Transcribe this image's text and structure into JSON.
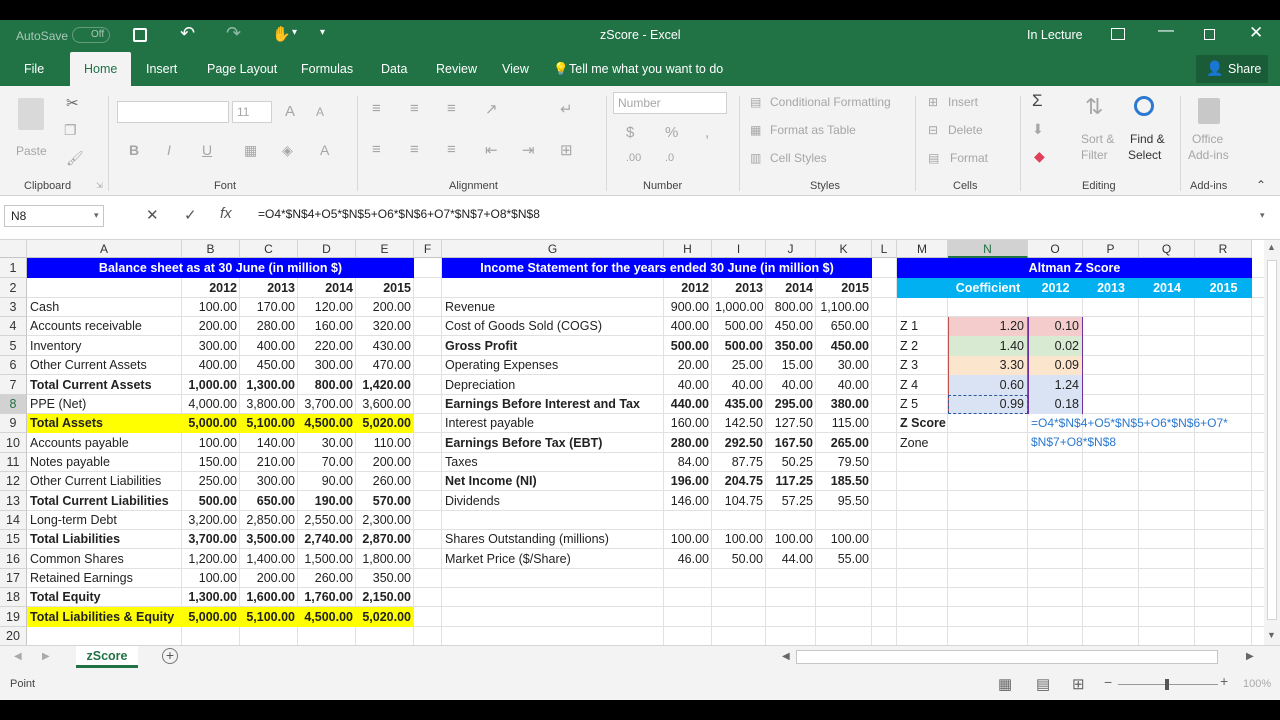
{
  "window": {
    "autosave": "AutoSave",
    "autosave_state": "Off",
    "title": "zScore  -  Excel",
    "user": "In Lecture"
  },
  "tabs": [
    "File",
    "Home",
    "Insert",
    "Page Layout",
    "Formulas",
    "Data",
    "Review",
    "View"
  ],
  "tell_me": "Tell me what you want to do",
  "share": "Share",
  "ribbon": {
    "paste": "Paste",
    "clipboard": "Clipboard",
    "font_size": "11",
    "font": "Font",
    "alignment": "Alignment",
    "number_format": "Number",
    "number": "Number",
    "conditional": "Conditional Formatting",
    "format_table": "Format as Table",
    "cell_styles": "Cell Styles",
    "styles": "Styles",
    "insert": "Insert",
    "delete": "Delete",
    "format": "Format",
    "cells": "Cells",
    "sort": "Sort &",
    "filter": "Filter",
    "find": "Find &",
    "select": "Select",
    "editing": "Editing",
    "office": "Office",
    "addins_btn": "Add-ins",
    "addins": "Add-ins"
  },
  "namebox": "N8",
  "formula": "=O4*$N$4+O5*$N$5+O6*$N$6+O7*$N$7+O8*$N$8",
  "columns": [
    "A",
    "B",
    "C",
    "D",
    "E",
    "F",
    "G",
    "H",
    "I",
    "J",
    "K",
    "L",
    "M",
    "N",
    "O",
    "P",
    "Q",
    "R"
  ],
  "rows": [
    "1",
    "2",
    "3",
    "4",
    "5",
    "6",
    "7",
    "8",
    "9",
    "10",
    "11",
    "12",
    "13",
    "14",
    "15",
    "16",
    "17",
    "18",
    "19",
    "20"
  ],
  "balance": {
    "title": "Balance sheet as at 30 June (in million $)",
    "years": [
      "2012",
      "2013",
      "2014",
      "2015"
    ],
    "items": [
      {
        "label": "Cash",
        "v": [
          "100.00",
          "170.00",
          "120.00",
          "200.00"
        ]
      },
      {
        "label": "Accounts receivable",
        "v": [
          "200.00",
          "280.00",
          "160.00",
          "320.00"
        ]
      },
      {
        "label": "Inventory",
        "v": [
          "300.00",
          "400.00",
          "220.00",
          "430.00"
        ]
      },
      {
        "label": "Other Current Assets",
        "v": [
          "400.00",
          "450.00",
          "300.00",
          "470.00"
        ]
      },
      {
        "label": "Total Current Assets",
        "v": [
          "1,000.00",
          "1,300.00",
          "800.00",
          "1,420.00"
        ]
      },
      {
        "label": "PPE (Net)",
        "v": [
          "4,000.00",
          "3,800.00",
          "3,700.00",
          "3,600.00"
        ]
      },
      {
        "label": "Total Assets",
        "v": [
          "5,000.00",
          "5,100.00",
          "4,500.00",
          "5,020.00"
        ]
      },
      {
        "label": "Accounts payable",
        "v": [
          "100.00",
          "140.00",
          "30.00",
          "110.00"
        ]
      },
      {
        "label": "Notes payable",
        "v": [
          "150.00",
          "210.00",
          "70.00",
          "200.00"
        ]
      },
      {
        "label": "Other Current Liabilities",
        "v": [
          "250.00",
          "300.00",
          "90.00",
          "260.00"
        ]
      },
      {
        "label": "Total Current Liabilities",
        "v": [
          "500.00",
          "650.00",
          "190.00",
          "570.00"
        ]
      },
      {
        "label": "Long-term Debt",
        "v": [
          "3,200.00",
          "2,850.00",
          "2,550.00",
          "2,300.00"
        ]
      },
      {
        "label": "Total Liabilities",
        "v": [
          "3,700.00",
          "3,500.00",
          "2,740.00",
          "2,870.00"
        ]
      },
      {
        "label": "Common Shares",
        "v": [
          "1,200.00",
          "1,400.00",
          "1,500.00",
          "1,800.00"
        ]
      },
      {
        "label": "Retained Earnings",
        "v": [
          "100.00",
          "200.00",
          "260.00",
          "350.00"
        ]
      },
      {
        "label": "Total Equity",
        "v": [
          "1,300.00",
          "1,600.00",
          "1,760.00",
          "2,150.00"
        ]
      },
      {
        "label": "Total Liabilities & Equity",
        "v": [
          "5,000.00",
          "5,100.00",
          "4,500.00",
          "5,020.00"
        ]
      }
    ]
  },
  "income": {
    "title": "Income Statement for the years ended 30 June (in million $)",
    "years": [
      "2012",
      "2013",
      "2014",
      "2015"
    ],
    "items": [
      {
        "label": "Revenue",
        "v": [
          "900.00",
          "1,000.00",
          "800.00",
          "1,100.00"
        ]
      },
      {
        "label": "Cost of Goods Sold (COGS)",
        "v": [
          "400.00",
          "500.00",
          "450.00",
          "650.00"
        ]
      },
      {
        "label": "Gross Profit",
        "v": [
          "500.00",
          "500.00",
          "350.00",
          "450.00"
        ]
      },
      {
        "label": "Operating Expenses",
        "v": [
          "20.00",
          "25.00",
          "15.00",
          "30.00"
        ]
      },
      {
        "label": "Depreciation",
        "v": [
          "40.00",
          "40.00",
          "40.00",
          "40.00"
        ]
      },
      {
        "label": "Earnings Before Interest and Tax",
        "v": [
          "440.00",
          "435.00",
          "295.00",
          "380.00"
        ]
      },
      {
        "label": "Interest payable",
        "v": [
          "160.00",
          "142.50",
          "127.50",
          "115.00"
        ]
      },
      {
        "label": "Earnings Before Tax (EBT)",
        "v": [
          "280.00",
          "292.50",
          "167.50",
          "265.00"
        ]
      },
      {
        "label": "Taxes",
        "v": [
          "84.00",
          "87.75",
          "50.25",
          "79.50"
        ]
      },
      {
        "label": "Net Income (NI)",
        "v": [
          "196.00",
          "204.75",
          "117.25",
          "185.50"
        ]
      },
      {
        "label": "Dividends",
        "v": [
          "146.00",
          "104.75",
          "57.25",
          "95.50"
        ]
      },
      {
        "label": "",
        "v": [
          "",
          "",
          "",
          ""
        ]
      },
      {
        "label": "Shares Outstanding (millions)",
        "v": [
          "100.00",
          "100.00",
          "100.00",
          "100.00"
        ]
      },
      {
        "label": "Market Price ($/Share)",
        "v": [
          "46.00",
          "50.00",
          "44.00",
          "55.00"
        ]
      }
    ]
  },
  "altman": {
    "title": "Altman Z Score",
    "coef_header": "Coefficient",
    "years": [
      "2012",
      "2013",
      "2014",
      "2015"
    ],
    "rows": [
      {
        "label": "Z 1",
        "coef": "1.20",
        "val": "0.10",
        "color": "#f4cccc"
      },
      {
        "label": "Z 2",
        "coef": "1.40",
        "val": "0.02",
        "color": "#d9ead3"
      },
      {
        "label": "Z 3",
        "coef": "3.30",
        "val": "0.09",
        "color": "#fce5cd"
      },
      {
        "label": "Z 4",
        "coef": "0.60",
        "val": "1.24",
        "color": "#dae3f3"
      },
      {
        "label": "Z 5",
        "coef": "0.99",
        "val": "0.18",
        "color": "#dae3f3"
      }
    ],
    "zscore": "Z Score",
    "zone": "Zone",
    "edit_line1": "=O4*$N$4+O5*$N$5+O6*$N$6+O7*",
    "edit_line2": "$N$7+O8*$N$8"
  },
  "sheet_tab": "zScore",
  "status": "Point",
  "zoom": "100%",
  "colors": {
    "excel_green": "#217346",
    "header_blue": "#0000ff",
    "header_cyan": "#00b0f0",
    "yellow": "#ffff00"
  }
}
